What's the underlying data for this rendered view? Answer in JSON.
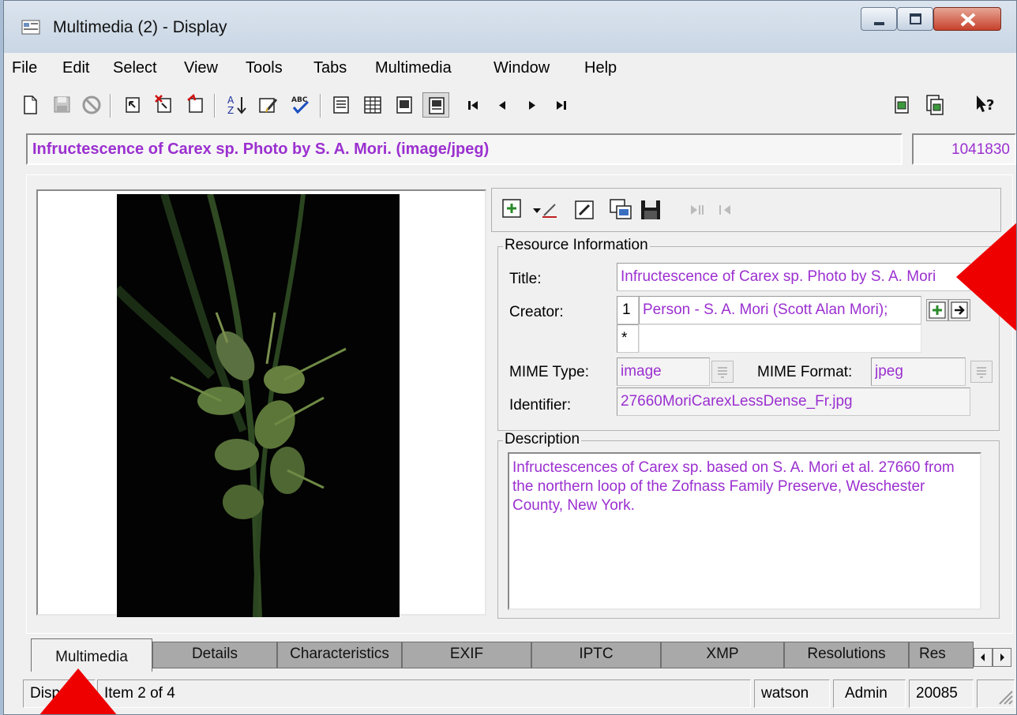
{
  "window": {
    "title": "Multimedia (2) - Display"
  },
  "menu": [
    "File",
    "Edit",
    "Select",
    "View",
    "Tools",
    "Tabs",
    "Multimedia",
    "Window",
    "Help"
  ],
  "record": {
    "title_line": "Infructescence of Carex sp. Photo by S. A. Mori. (image/jpeg)",
    "irn": "1041830"
  },
  "resource_info": {
    "group_label": "Resource Information",
    "title_label": "Title:",
    "title_value": "Infructescence of Carex sp. Photo by S. A. Mori",
    "creator_label": "Creator:",
    "creator_index": "1",
    "creator_value": "Person - S. A. Mori (Scott Alan Mori);",
    "new_row_marker": "*",
    "mime_type_label": "MIME Type:",
    "mime_type_value": "image",
    "mime_format_label": "MIME Format:",
    "mime_format_value": "jpeg",
    "identifier_label": "Identifier:",
    "identifier_value": "27660MoriCarexLessDense_Fr.jpg"
  },
  "description": {
    "group_label": "Description",
    "text": "Infructescences of Carex sp. based on S. A. Mori et al. 27660 from the northern loop of the Zofnass Family Preserve, Weschester County, New York."
  },
  "tabs": [
    "Multimedia",
    "Details",
    "Characteristics",
    "EXIF",
    "IPTC",
    "XMP",
    "Resolutions",
    "Res"
  ],
  "active_tab": "Multimedia",
  "status": {
    "mode": "Disp",
    "item": "Item 2 of 4",
    "user": "watson",
    "group": "Admin",
    "count": "20085"
  },
  "colors": {
    "value_text": "#9b30d0",
    "annotation_marker": "#ee0000"
  },
  "icons": {
    "toolbar": [
      "new-record-icon",
      "save-icon",
      "cancel-icon",
      "edit-record-icon",
      "delete-record-icon",
      "new-from-icon",
      "sort-icon",
      "edit-list-icon",
      "spell-check-icon",
      "details-view-icon",
      "list-view-icon",
      "page-view-icon",
      "display-view-icon",
      "first-record-icon",
      "previous-record-icon",
      "next-record-icon",
      "last-record-icon",
      "attach-icon",
      "copy-attach-icon",
      "help-icon"
    ],
    "viewer": [
      "add-image-icon",
      "rotate-icon",
      "edit-image-icon",
      "view-image-icon",
      "save-image-icon",
      "play-icon",
      "back-icon"
    ]
  }
}
